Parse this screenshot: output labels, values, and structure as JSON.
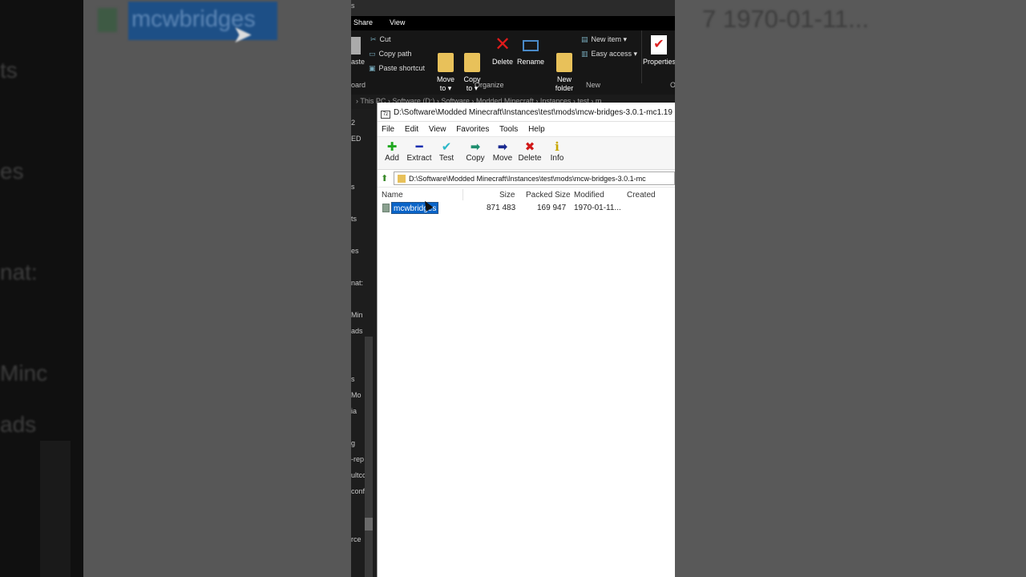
{
  "background": {
    "left_selected_name": "mcwbridges",
    "left_partial_texts": [
      "ts",
      "es",
      "nat:",
      "Minc",
      "ads"
    ],
    "right_partial_text": "7 1970-01-11..."
  },
  "explorer": {
    "top_fragment": "s",
    "tabs": [
      "Share",
      "View"
    ],
    "clipboard_items": [
      "Cut",
      "Copy path",
      "Paste shortcut"
    ],
    "paste_fragment": "aste",
    "buttons": {
      "move_to": "Move\nto ▾",
      "copy_to": "Copy\nto ▾",
      "delete": "Delete",
      "rename": "Rename",
      "new_folder": "New\nfolder",
      "new_item": "New item ▾",
      "easy_access": "Easy access ▾",
      "properties": "Properties"
    },
    "groups": [
      "oard",
      "Organize",
      "New",
      "O"
    ],
    "address": "›  This PC  ›  Software (D:)  ›  Software  ›  Modded Minecraft  ›  Instances  ›  test  ›  m",
    "nav_fragments": [
      "2",
      "ED",
      "s",
      "ts",
      "es",
      "nat:",
      "Min",
      "ads",
      "s",
      "Mo",
      "ia",
      "g",
      "-rep",
      "ultcc",
      "conf",
      "rce"
    ]
  },
  "zip": {
    "title": "D:\\Software\\Modded Minecraft\\Instances\\test\\mods\\mcw-bridges-3.0.1-mc1.19",
    "menu": [
      "File",
      "Edit",
      "View",
      "Favorites",
      "Tools",
      "Help"
    ],
    "toolbar": [
      {
        "label": "Add",
        "icon": "add-icon",
        "glyph": "✚",
        "color": "#1fa81f"
      },
      {
        "label": "Extract",
        "icon": "extract-icon",
        "glyph": "━",
        "color": "#1a2fb0"
      },
      {
        "label": "Test",
        "icon": "test-icon",
        "glyph": "✔",
        "color": "#2cb8c8"
      },
      {
        "label": "Copy",
        "icon": "copy-icon",
        "glyph": "➡",
        "color": "#1f8f6f"
      },
      {
        "label": "Move",
        "icon": "move-icon",
        "glyph": "➡",
        "color": "#1a2a90"
      },
      {
        "label": "Delete",
        "icon": "delete-icon",
        "glyph": "✖",
        "color": "#d01818"
      },
      {
        "label": "Info",
        "icon": "info-icon",
        "glyph": "ℹ",
        "color": "#c8a800"
      }
    ],
    "path": "D:\\Software\\Modded Minecraft\\Instances\\test\\mods\\mcw-bridges-3.0.1-mc",
    "columns": [
      "Name",
      "Size",
      "Packed Size",
      "Modified",
      "Created"
    ],
    "files": [
      {
        "name": "mcwbridges",
        "size": "871 483",
        "packed": "169 947",
        "modified": "1970-01-11..."
      }
    ]
  }
}
